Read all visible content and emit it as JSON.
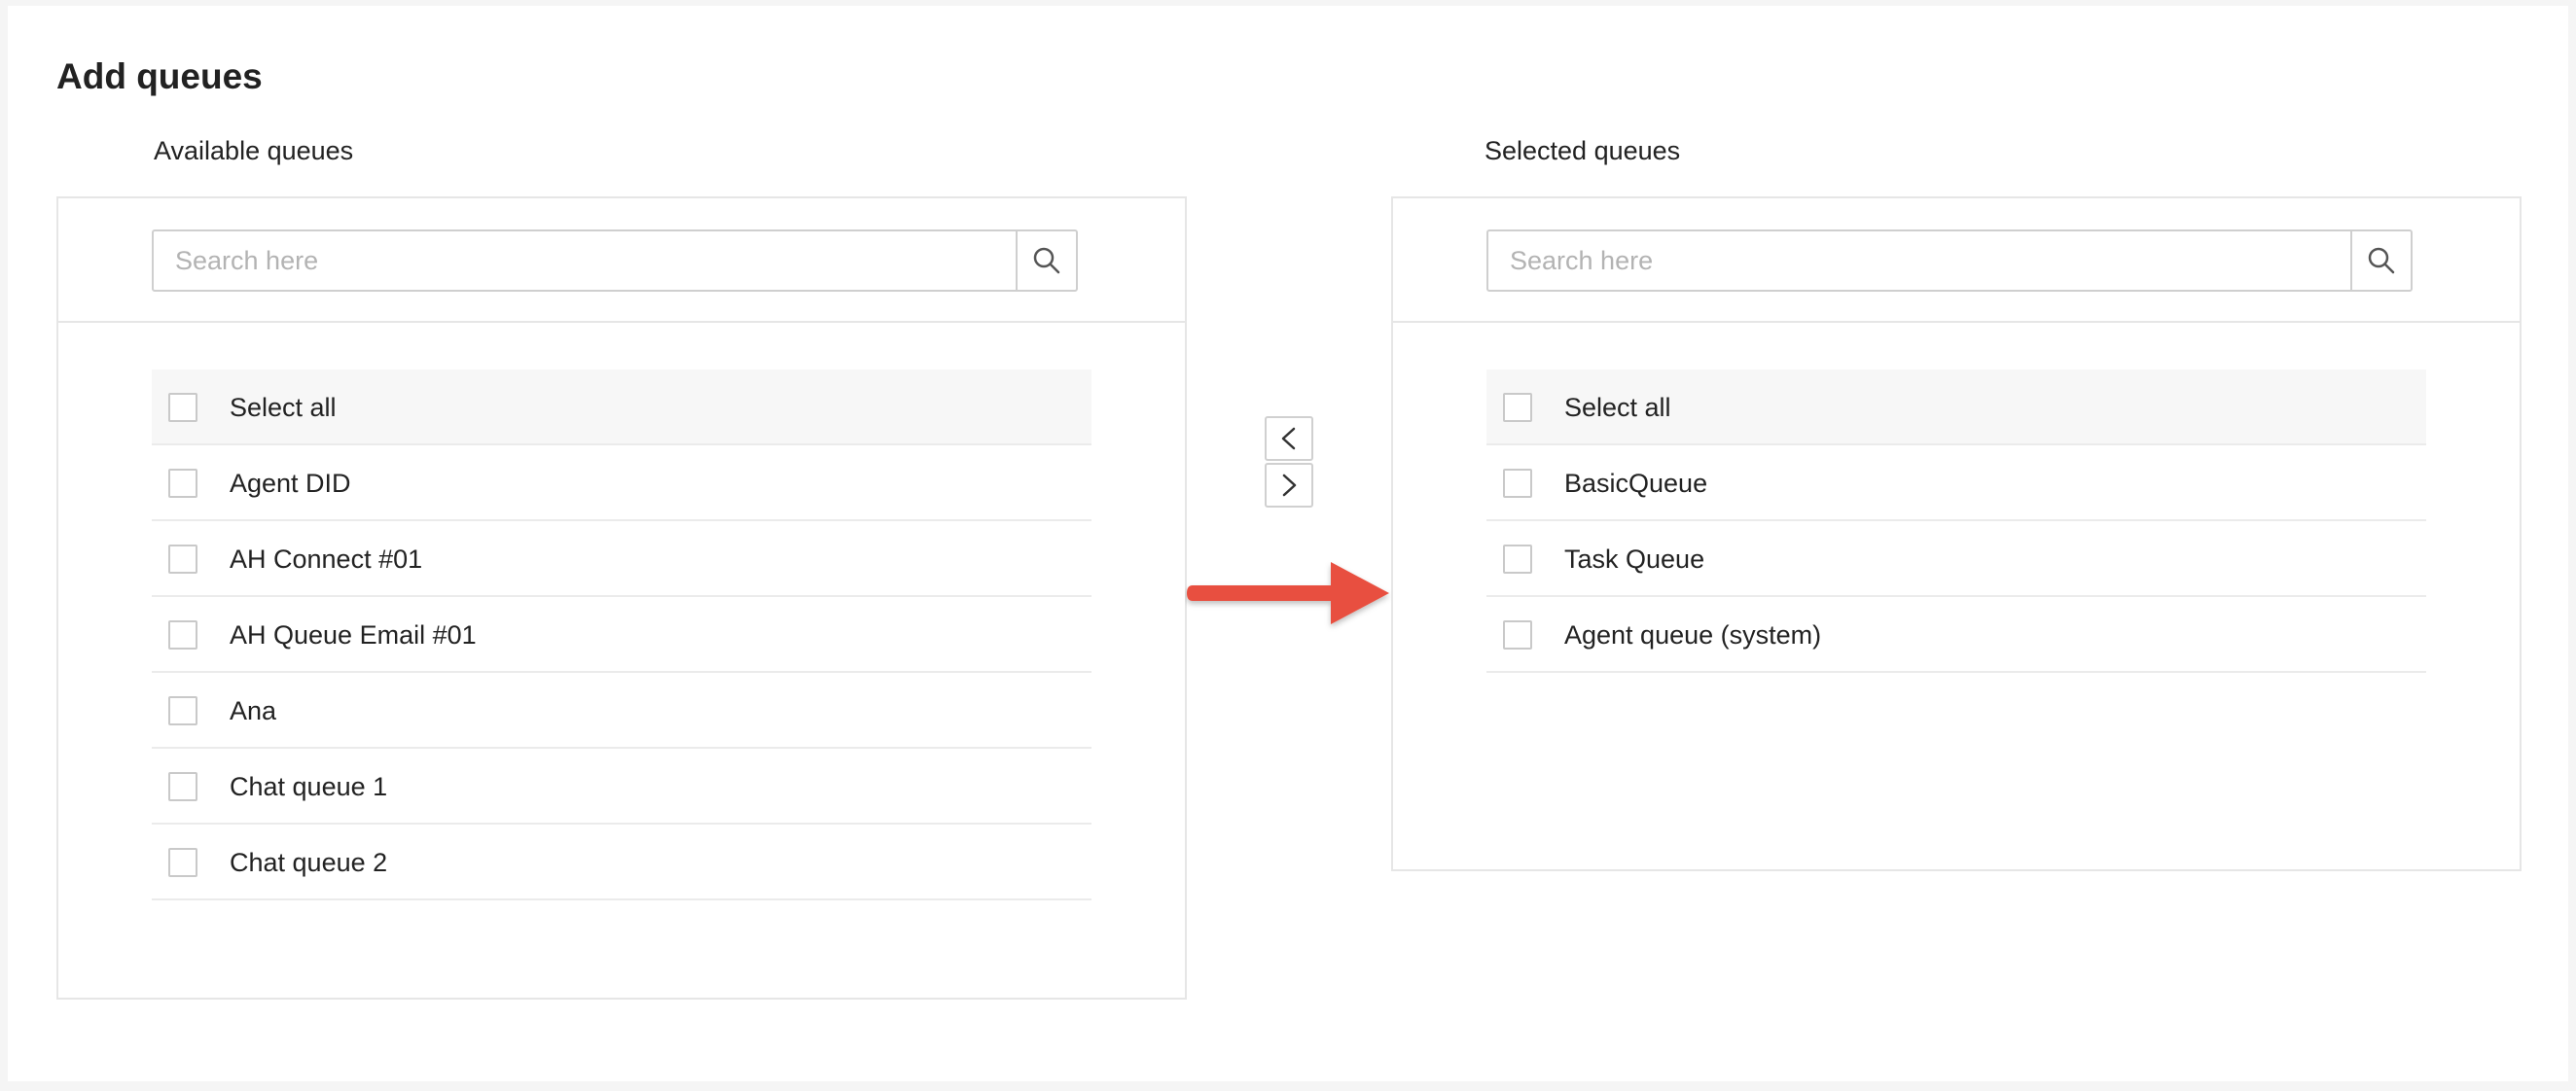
{
  "page_title": "Add queues",
  "available": {
    "label": "Available queues",
    "search_placeholder": "Search here",
    "select_all": "Select all",
    "items": [
      "Agent DID",
      "AH Connect #01",
      "AH Queue Email #01",
      "Ana",
      "Chat queue 1",
      "Chat queue 2"
    ]
  },
  "selected": {
    "label": "Selected queues",
    "search_placeholder": "Search here",
    "select_all": "Select all",
    "items": [
      "BasicQueue",
      "Task Queue",
      "Agent queue (system)"
    ]
  },
  "transfer": {
    "move_left_icon": "chevron-left-icon",
    "move_right_icon": "chevron-right-icon"
  },
  "annotation": {
    "arrow_color": "#e8503f"
  },
  "colors": {
    "border": "#e6e6e6",
    "header_row_bg": "#f7f7f7",
    "text": "#222222",
    "placeholder": "#b3b3b3"
  }
}
